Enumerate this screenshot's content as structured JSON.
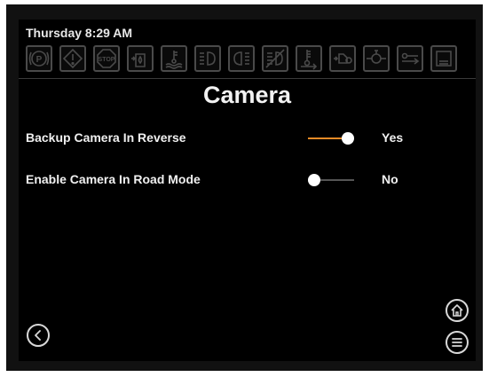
{
  "status_bar": {
    "time": "Thursday 8:29 AM"
  },
  "warning_icons": [
    "parking-brake-icon",
    "warning-icon",
    "stop-icon",
    "fuel-water-icon",
    "coolant-level-icon",
    "left-headlight-icon",
    "right-headlight-icon",
    "high-beam-off-icon",
    "coolant-temperature-icon",
    "transmission-icon",
    "oil-pressure-icon",
    "low-fuel-icon",
    "tank-level-icon"
  ],
  "page": {
    "title": "Camera"
  },
  "settings": [
    {
      "label": "Backup Camera In Reverse",
      "enabled": true,
      "value": "Yes"
    },
    {
      "label": "Enable Camera In Road Mode",
      "enabled": false,
      "value": "No"
    }
  ],
  "colors": {
    "accent": "#e88b26",
    "background": "#000000",
    "text": "#f0f0f0",
    "icon_inactive": "#4a4a4a"
  }
}
